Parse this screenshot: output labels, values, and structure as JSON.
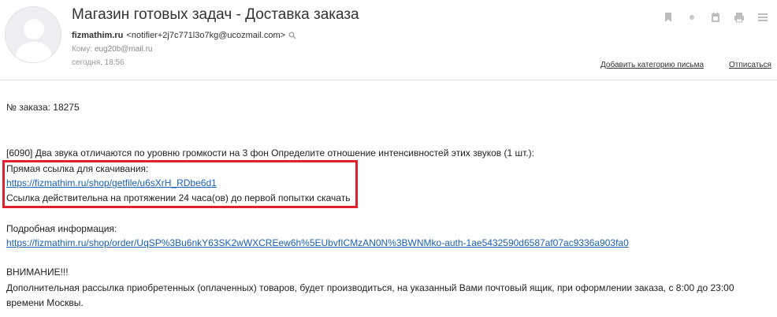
{
  "header": {
    "subject": "Магазин готовых задач - Доставка заказа",
    "from_name": "fizmathim.ru",
    "from_email": "<notifier+2j7c771l3o7kg@ucozmail.com>",
    "to_label": "Кому:",
    "to_address": "eug20b@mail.ru",
    "date": "сегодня, 18:56",
    "add_category": "Добавить категорию письма",
    "unsubscribe": "Отписаться"
  },
  "toolbar": {
    "icons": [
      "bookmark-icon",
      "circle-icon",
      "calendar-icon",
      "print-icon",
      "more-icon"
    ]
  },
  "body": {
    "order_number": "№ заказа: 18275",
    "item_line": "[6090] Два звука отличаются по уровню громкости на 3 фон Определите отношение интенсивностей этих звуков (1 шт.):",
    "direct_link_label": "Прямая ссылка для скачивания:",
    "direct_link": "https://fizmathim.ru/shop/getfile/u6sXrH_RDbe6d1",
    "validity_note": "Ссылка действительна на протяжении 24 часа(ов) до первой попытки скачать",
    "details_label": "Подробная информация:",
    "details_link": "https://fizmathim.ru/shop/order/UqSP%3Bu6nkY63SK2wWXCREew6h%5EUbvfICMzAN0N%3BWNMko-auth-1ae5432590d6587af07ac9336a903fa0",
    "warning_title": "ВНИМАНИЕ!!!",
    "warning_text_1": "Дополнительная рассылка приобретенных (оплаченных) товаров, будет производиться, на указанный Вами почтовый ящик, при оформлении заказа, с 8:00 до 23:00",
    "warning_text_2": "времени Москвы."
  },
  "colors": {
    "link": "#1a5fb4",
    "highlight": "#e0202c"
  }
}
